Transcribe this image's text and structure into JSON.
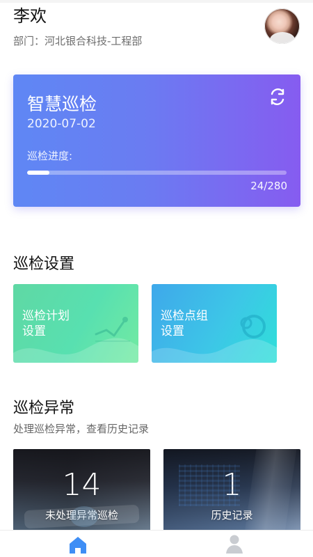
{
  "user": {
    "name": "李欢",
    "department": "部门：河北银合科技-工程部"
  },
  "inspection_card": {
    "title": "智慧巡检",
    "date": "2020-07-02",
    "progress_label": "巡检进度:",
    "completed": 24,
    "total": 280,
    "progress_text": "24/280",
    "progress_fraction": 0.0857
  },
  "settings": {
    "title": "巡检设置",
    "tiles": [
      {
        "label": "巡检计划\n设置",
        "icon": "plan-chart-icon"
      },
      {
        "label": "巡检点组\n设置",
        "icon": "group-circle-icon"
      }
    ]
  },
  "abnormal": {
    "title": "巡检异常",
    "subtitle": "处理巡检异常，查看历史记录",
    "cards": [
      {
        "value": "14",
        "label": "未处理异常巡检"
      },
      {
        "value": "1",
        "label": "历史记录"
      }
    ]
  },
  "nav": {
    "items": [
      {
        "icon": "home-icon",
        "active": true
      },
      {
        "icon": "user-icon",
        "active": false
      }
    ]
  },
  "colors": {
    "primary_blue": "#3f8ef5",
    "card_gradient_start": "#5f87f4",
    "card_gradient_end": "#865cf0",
    "tile_green": "#5fd8a4",
    "tile_cyan": "#2fdfd9",
    "inactive_nav": "#c9ccd1"
  }
}
